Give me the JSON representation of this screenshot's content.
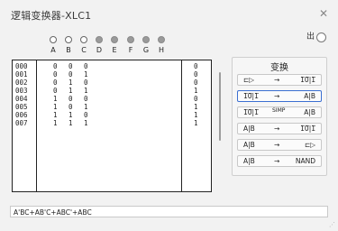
{
  "window": {
    "title": "逻辑变换器-XLC1",
    "close_glyph": "✕",
    "output_label": "出"
  },
  "inputs": [
    {
      "label": "A",
      "state": "open"
    },
    {
      "label": "B",
      "state": "open"
    },
    {
      "label": "C",
      "state": "open"
    },
    {
      "label": "D",
      "state": "filled"
    },
    {
      "label": "E",
      "state": "filled"
    },
    {
      "label": "F",
      "state": "filled"
    },
    {
      "label": "G",
      "state": "filled"
    },
    {
      "label": "H",
      "state": "filled"
    }
  ],
  "truth_table": {
    "rows": [
      {
        "index": "000",
        "a": "0",
        "b": "0",
        "c": "0",
        "out": "0"
      },
      {
        "index": "001",
        "a": "0",
        "b": "0",
        "c": "1",
        "out": "0"
      },
      {
        "index": "002",
        "a": "0",
        "b": "1",
        "c": "0",
        "out": "0"
      },
      {
        "index": "003",
        "a": "0",
        "b": "1",
        "c": "1",
        "out": "1"
      },
      {
        "index": "004",
        "a": "1",
        "b": "0",
        "c": "0",
        "out": "0"
      },
      {
        "index": "005",
        "a": "1",
        "b": "0",
        "c": "1",
        "out": "1"
      },
      {
        "index": "006",
        "a": "1",
        "b": "1",
        "c": "0",
        "out": "1"
      },
      {
        "index": "007",
        "a": "1",
        "b": "1",
        "c": "1",
        "out": "1"
      }
    ]
  },
  "conversions": {
    "title": "变换",
    "buttons": [
      {
        "left": "⊏▷",
        "arrow": "→",
        "right": "1̅0̅|1̅",
        "selected": false
      },
      {
        "left": "1̅0̅|1̅",
        "arrow": "→",
        "right": "A|B",
        "selected": true
      },
      {
        "left": "1̅0̅|1̅",
        "arrow": "SIMP",
        "right": "A|B",
        "selected": false
      },
      {
        "left": "A|B",
        "arrow": "→",
        "right": "1̅0̅|1̅",
        "selected": false
      },
      {
        "left": "A|B",
        "arrow": "→",
        "right": "⊏▷",
        "selected": false
      },
      {
        "left": "A|B",
        "arrow": "→",
        "right": "NAND",
        "selected": false
      }
    ]
  },
  "expression": {
    "value": "A'BC+AB'C+ABC'+ABC"
  },
  "colors": {
    "selected_border": "#3b6fd1",
    "filled_input": "#9a9a9a"
  }
}
